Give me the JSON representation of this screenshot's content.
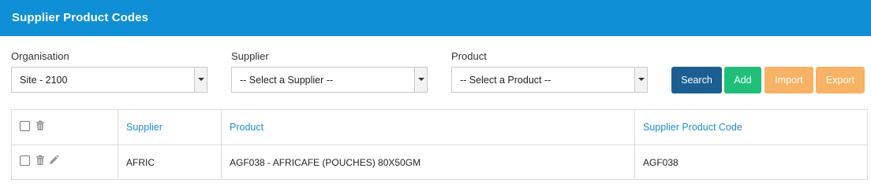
{
  "header": {
    "title": "Supplier Product Codes"
  },
  "filters": {
    "organisation": {
      "label": "Organisation",
      "value": "Site - 2100"
    },
    "supplier": {
      "label": "Supplier",
      "value": "-- Select a Supplier --"
    },
    "product": {
      "label": "Product",
      "value": "-- Select a Product --"
    }
  },
  "buttons": {
    "search": "Search",
    "add": "Add",
    "import": "Import",
    "export": "Export"
  },
  "table": {
    "columns": [
      "Supplier",
      "Product",
      "Supplier Product Code"
    ],
    "rows": [
      {
        "supplier": "AFRIC",
        "product": "AGF038 - AFRICAFE (POUCHES) 80X50GM",
        "code": "AGF038"
      }
    ]
  },
  "colors": {
    "header": "#0f8fd6",
    "search": "#1a5e92",
    "add": "#1fbf77",
    "import_export": "#f7b264",
    "column_header_text": "#1a8fd1"
  }
}
